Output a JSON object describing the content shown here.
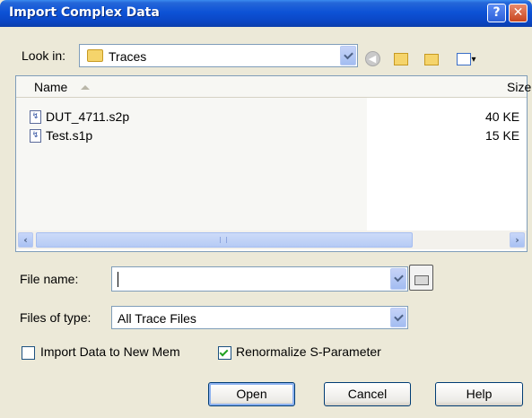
{
  "window": {
    "title": "Import Complex Data",
    "help_glyph": "?",
    "close_glyph": "✕"
  },
  "lookin": {
    "label": "Look in:",
    "value": "Traces"
  },
  "toolbar": {
    "back_icon": "back-icon",
    "up_icon": "up-folder-icon",
    "new_folder_icon": "new-folder-icon",
    "view_icon": "view-menu-icon"
  },
  "list": {
    "columns": [
      "Name",
      "Size"
    ],
    "files": [
      {
        "name": "DUT_4711.s2p",
        "size": "40 KE"
      },
      {
        "name": "Test.s1p",
        "size": "15 KE"
      }
    ]
  },
  "filename": {
    "label": "File name:",
    "value": ""
  },
  "filetype": {
    "label": "Files of type:",
    "value": "All Trace Files"
  },
  "options": {
    "import_new_mem": {
      "label": "Import Data to New Mem",
      "checked": false
    },
    "renormalize": {
      "label": "Renormalize S-Parameter",
      "checked": true
    }
  },
  "buttons": {
    "open": "Open",
    "cancel": "Cancel",
    "help": "Help"
  },
  "colors": {
    "titlebar": "#0a46c4",
    "dialog_bg": "#ece9d8",
    "accent": "#7f9db9"
  }
}
